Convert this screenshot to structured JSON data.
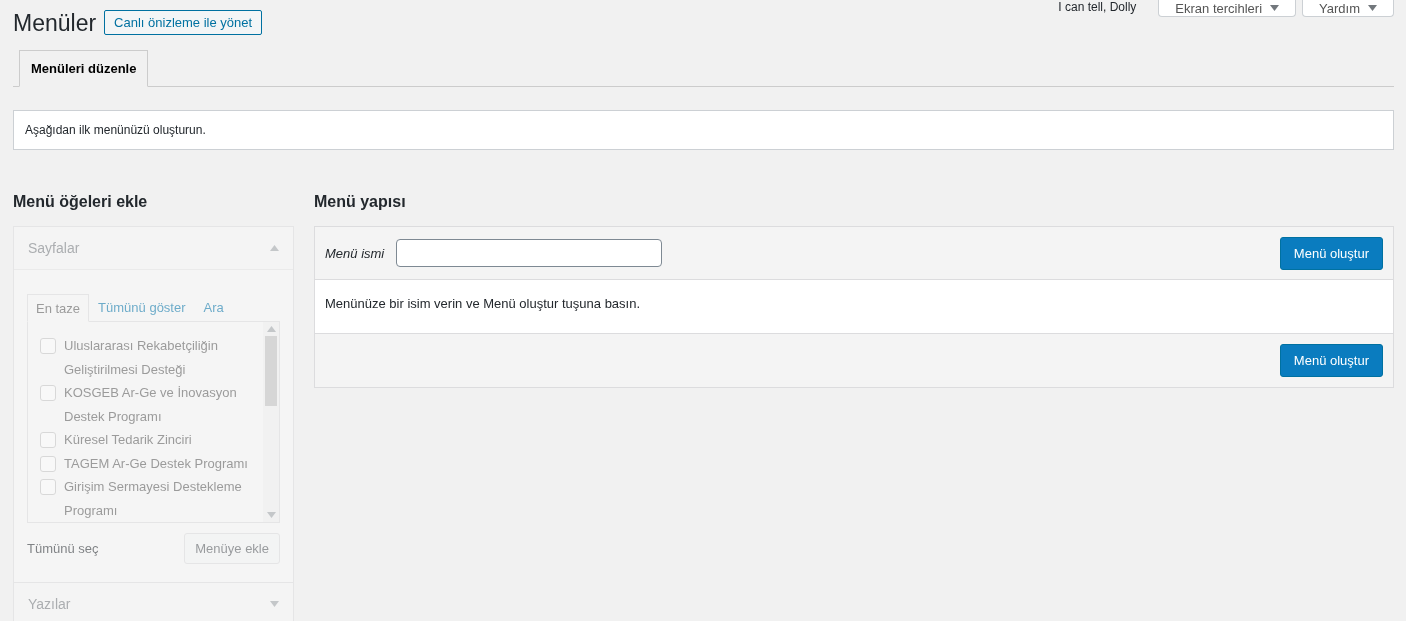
{
  "header": {
    "title": "Menüler",
    "action": "Canlı önizleme ile yönet",
    "greeting": "I can tell, Dolly",
    "buttons": [
      {
        "label": "Ekran tercihleri"
      },
      {
        "label": "Yardım"
      }
    ]
  },
  "tabs": [
    {
      "label": "Menüleri düzenle",
      "selected": true
    }
  ],
  "notice": "Aşağıdan ilk menünüzü oluşturun.",
  "add_items": {
    "title": "Menü öğeleri ekle",
    "disabled": true,
    "sections": [
      {
        "title": "Sayfalar",
        "expanded": true,
        "tabs": [
          {
            "label": "En taze",
            "selected": true
          },
          {
            "label": "Tümünü göster",
            "selected": false
          },
          {
            "label": "Ara",
            "selected": false
          }
        ],
        "items": [
          {
            "label": "Uluslararası Rekabetçiliğin Geliştirilmesi Desteği",
            "checked": false
          },
          {
            "label": "KOSGEB Ar-Ge ve İnovasyon Destek Programı",
            "checked": false
          },
          {
            "label": "Küresel Tedarik Zinciri",
            "checked": false
          },
          {
            "label": "TAGEM Ar-Ge Destek Programı",
            "checked": false
          },
          {
            "label": "Girişim Sermayesi Destekleme Programı",
            "checked": false
          }
        ],
        "select_all": "Tümünü seç",
        "add_button": "Menüye ekle"
      },
      {
        "title": "Yazılar",
        "expanded": false
      }
    ]
  },
  "structure": {
    "title": "Menü yapısı",
    "name_label": "Menü ismi",
    "create_button": "Menü oluştur",
    "instructions": "Menünüze bir isim verin ve Menü oluştur tuşuna basın.",
    "footer_button": "Menü oluştur"
  }
}
